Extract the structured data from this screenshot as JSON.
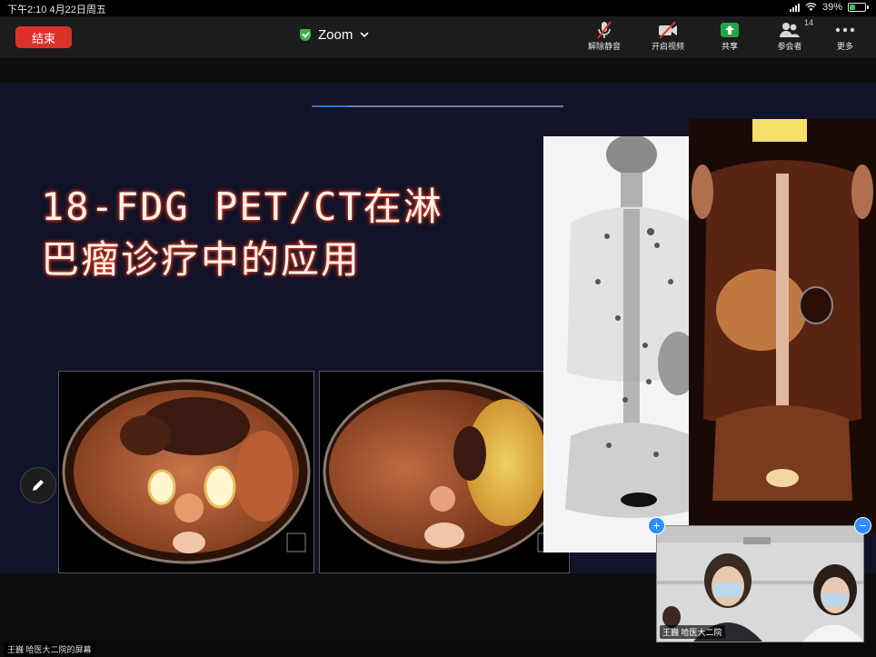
{
  "status_bar": {
    "time_date": "下午2:10   4月22日周五",
    "battery": "39%",
    "battery_level": 0.39
  },
  "toolbar": {
    "end_label": "结束",
    "app_title": "Zoom",
    "items": [
      {
        "label": "解除静音",
        "icon": "mic-muted-icon"
      },
      {
        "label": "开启视频",
        "icon": "video-off-icon"
      },
      {
        "label": "共享",
        "icon": "share-icon"
      },
      {
        "label": "参会者",
        "icon": "participants-icon",
        "count": "14"
      },
      {
        "label": "更多",
        "icon": "more-icon"
      }
    ],
    "accent_green": "#3bb34a",
    "end_color": "#d9322b"
  },
  "slide": {
    "title_line1": "18-FDG PET/CT在淋",
    "title_line2": "巴瘤诊疗中的应用"
  },
  "video_tile": {
    "name": "王巍 哈医大二院",
    "add_icon": "+",
    "minimize_icon": "−"
  },
  "share_label": "王巍 哈医大二院的屏幕"
}
